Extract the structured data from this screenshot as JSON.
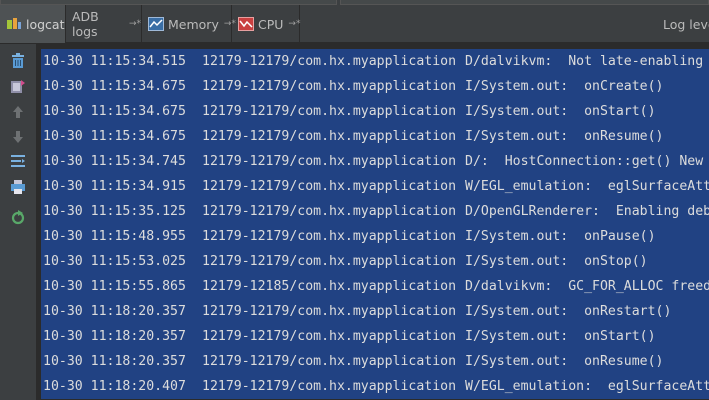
{
  "tabs": [
    {
      "label": "logcat",
      "active": true,
      "icon": "android-icon"
    },
    {
      "label": "ADB logs",
      "active": false,
      "icon": "",
      "pin": "→*"
    },
    {
      "label": "Memory",
      "active": false,
      "icon": "memory-chart-icon",
      "pin": "→*"
    },
    {
      "label": "CPU",
      "active": false,
      "icon": "cpu-chart-icon",
      "pin": "→*"
    }
  ],
  "log_level_label": "Log level",
  "toolbar_icons": [
    "trash-icon",
    "restart-icon",
    "arrow-up-icon",
    "arrow-down-icon",
    "soft-wrap-icon",
    "print-icon",
    "refresh-icon"
  ],
  "log_rows": [
    {
      "time": "10-30 11:15:34.515",
      "pid": "12179-12179/com.hx.myapplication",
      "tag": "D/dalvikvm:  Not late-enabling"
    },
    {
      "time": "10-30 11:15:34.675",
      "pid": "12179-12179/com.hx.myapplication",
      "tag": "I/System.out:  onCreate()"
    },
    {
      "time": "10-30 11:15:34.675",
      "pid": "12179-12179/com.hx.myapplication",
      "tag": "I/System.out:  onStart()"
    },
    {
      "time": "10-30 11:15:34.675",
      "pid": "12179-12179/com.hx.myapplication",
      "tag": "I/System.out:  onResume()"
    },
    {
      "time": "10-30 11:15:34.745",
      "pid": "12179-12179/com.hx.myapplication",
      "tag": "D/:  HostConnection::get() New"
    },
    {
      "time": "10-30 11:15:34.915",
      "pid": "12179-12179/com.hx.myapplication",
      "tag": "W/EGL_emulation:  eglSurfaceAtt"
    },
    {
      "time": "10-30 11:15:35.125",
      "pid": "12179-12179/com.hx.myapplication",
      "tag": "D/OpenGLRenderer:  Enabling deb"
    },
    {
      "time": "10-30 11:15:48.955",
      "pid": "12179-12179/com.hx.myapplication",
      "tag": "I/System.out:  onPause()"
    },
    {
      "time": "10-30 11:15:53.025",
      "pid": "12179-12179/com.hx.myapplication",
      "tag": "I/System.out:  onStop()"
    },
    {
      "time": "10-30 11:15:55.865",
      "pid": "12179-12185/com.hx.myapplication",
      "tag": "D/dalvikvm:  GC_FOR_ALLOC freed"
    },
    {
      "time": "10-30 11:18:20.357",
      "pid": "12179-12179/com.hx.myapplication",
      "tag": "I/System.out:  onRestart()"
    },
    {
      "time": "10-30 11:18:20.357",
      "pid": "12179-12179/com.hx.myapplication",
      "tag": "I/System.out:  onStart()"
    },
    {
      "time": "10-30 11:18:20.357",
      "pid": "12179-12179/com.hx.myapplication",
      "tag": "I/System.out:  onResume()"
    },
    {
      "time": "10-30 11:18:20.407",
      "pid": "12179-12179/com.hx.myapplication",
      "tag": "W/EGL_emulation:  eglSurfaceAtt"
    }
  ],
  "colors": {
    "selection": "#214283",
    "panel": "#3c3f41",
    "background": "#2b2b2b",
    "text": "#dcdcdc"
  }
}
